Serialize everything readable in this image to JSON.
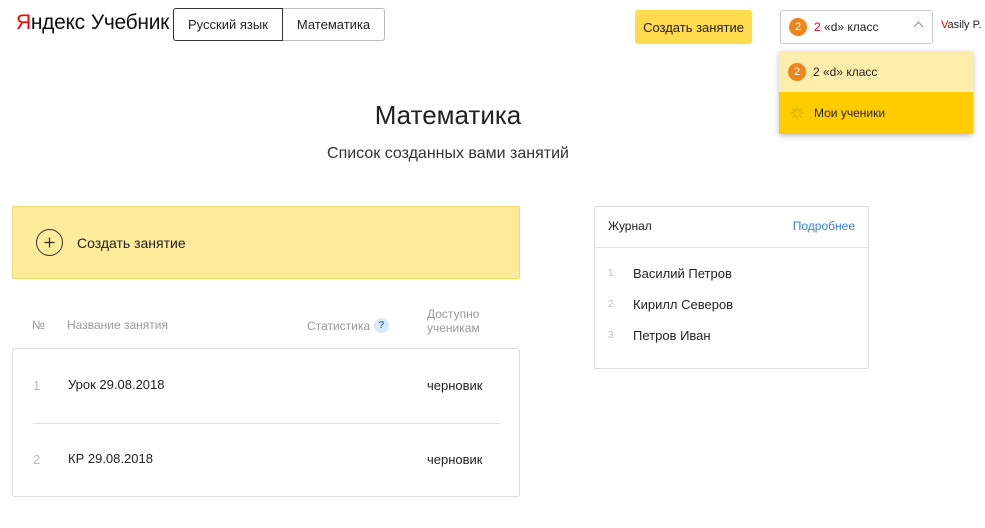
{
  "header": {
    "logo_brand": "Яндекс",
    "logo_product": "Учебник",
    "subjects": [
      "Русский язык",
      "Математика"
    ],
    "create_button": "Создать занятие",
    "class_select": {
      "badge": "2",
      "num": "2",
      "label": " «d» класс"
    },
    "user": {
      "first_letter": "V",
      "rest": "asily P."
    }
  },
  "dropdown": {
    "items": [
      {
        "badge": "2",
        "label": "2 «d» класс"
      },
      {
        "icon": "gear-icon",
        "label": "Мои ученики"
      }
    ]
  },
  "main": {
    "title": "Математика",
    "subtitle": "Список созданных вами занятий",
    "create_panel_label": "Создать занятие"
  },
  "table": {
    "headers": {
      "num": "№",
      "name": "Название занятия",
      "stats": "Статистика",
      "stats_help": "?",
      "available": "Доступно ученикам"
    },
    "rows": [
      {
        "n": "1",
        "name": "Урок 29.08.2018",
        "status": "черновик"
      },
      {
        "n": "2",
        "name": "КР 29.08.2018",
        "status": "черновик"
      }
    ]
  },
  "journal": {
    "title": "Журнал",
    "more": "Подробнее",
    "students": [
      {
        "n": "1",
        "name": "Василий Петров"
      },
      {
        "n": "2",
        "name": "Кирилл Северов"
      },
      {
        "n": "3",
        "name": "Петров Иван"
      }
    ]
  },
  "colors": {
    "accent_yellow": "#ffdb4d",
    "badge_orange": "#f08417",
    "link_blue": "#3d7fd1",
    "brand_red": "#ff0000"
  }
}
